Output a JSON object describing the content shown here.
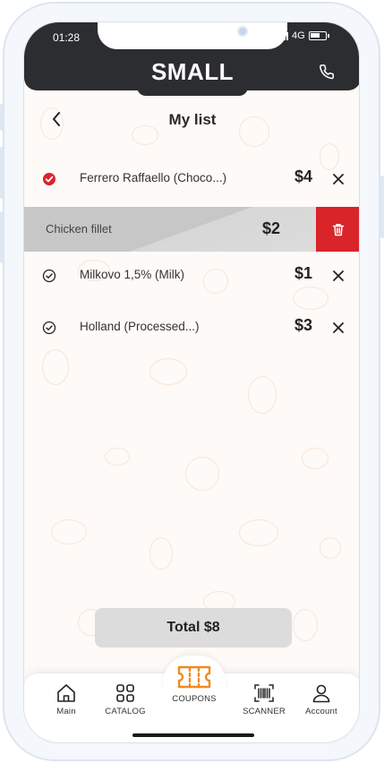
{
  "status_bar": {
    "time": "01:28",
    "network": "4G"
  },
  "header": {
    "brand": "SMALL",
    "icons": [
      "phone-icon"
    ]
  },
  "page": {
    "title": "My list",
    "back_icon": "chevron-left-icon"
  },
  "items": [
    {
      "name": "Ferrero Raffaello (Choco...)",
      "price": "$4",
      "checked": true
    },
    {
      "name": "Chicken fillet",
      "price": "$2",
      "swiped": true
    },
    {
      "name": "Milkovo 1,5% (Milk)",
      "price": "$1",
      "checked": false
    },
    {
      "name": "Holland (Processed...)",
      "price": "$3",
      "checked": false
    }
  ],
  "total_label": "Total $8",
  "nav": {
    "main": "Main",
    "catalog": "CATALOG",
    "coupons": "COUPONS",
    "scanner": "SCANNER",
    "account": "Account"
  },
  "colors": {
    "accent_red": "#d9242a",
    "header_dark": "#2b2d31",
    "coupon_orange": "#f28a1e"
  }
}
